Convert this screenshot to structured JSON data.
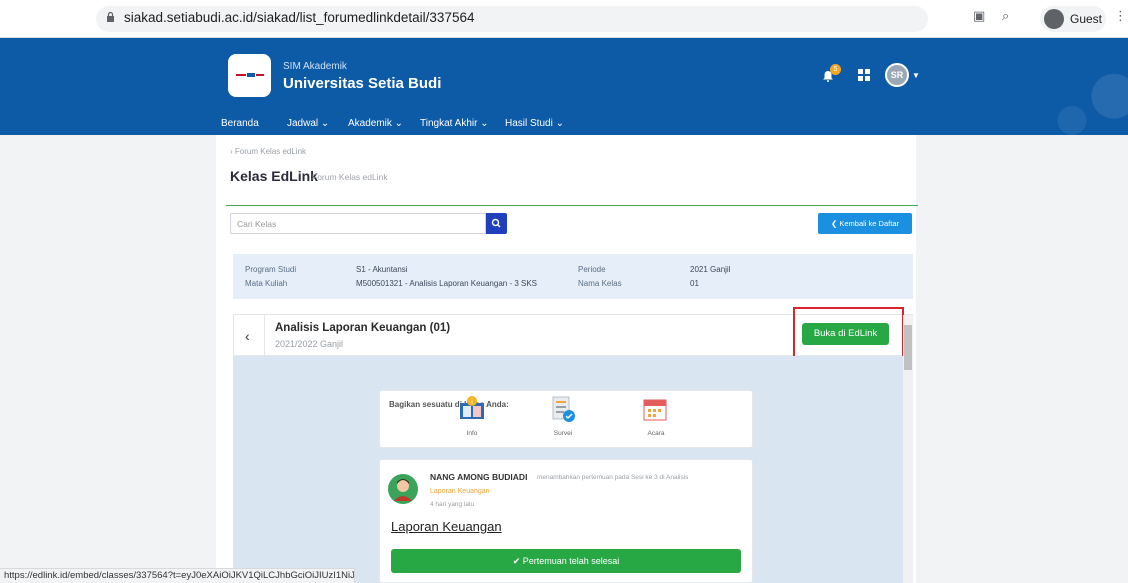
{
  "browser": {
    "url": "siakad.setiabudi.ac.id/siakad/list_forumedlinkdetail/337564",
    "profile_label": "Guest",
    "status_url": "https://edlink.id/embed/classes/337564?t=eyJ0eXAiOiJKV1QiLCJhbGciOiJIUzI1NiJ..."
  },
  "header": {
    "app_label": "SIM Akademik",
    "university": "Universitas Setia Budi",
    "notification_count": "5",
    "avatar_initials": "SR",
    "menu": [
      "Beranda",
      "Jadwal",
      "Akademik",
      "Tingkat Akhir",
      "Hasil Studi"
    ]
  },
  "page": {
    "breadcrumb": "Forum Kelas edLink",
    "title": "Kelas EdLink",
    "subtitle": "Forum Kelas edLink",
    "search_placeholder": "Cari Kelas",
    "back_button": "Kembali ke Daftar"
  },
  "info": {
    "program_label": "Program Studi",
    "program_value": "S1 - Akuntansi",
    "course_label": "Mata Kuliah",
    "course_value": "M500501321 - Analisis Laporan Keuangan - 3 SKS",
    "period_label": "Periode",
    "period_value": "2021 Ganjil",
    "class_label": "Nama Kelas",
    "class_value": "01"
  },
  "embed": {
    "class_title": "Analisis Laporan Keuangan (01)",
    "class_period": "2021/2022 Ganjil",
    "open_button": "Buka di EdLink",
    "share_title": "Bagikan sesuatu di kelas Anda:",
    "share_items": [
      "Info",
      "Survei",
      "Acara"
    ]
  },
  "post": {
    "author": "NANG AMONG BUDIADI",
    "action": "menambahkan pertemuan pada Sesi ke 3 di Analisis",
    "action_cont": "Laporan Keuangan",
    "time": "4 hari yang lalu",
    "heading": "Laporan Keuangan",
    "status": "Pertemuan telah selesai"
  },
  "colors": {
    "header_blue": "#0d5aa7",
    "accent_green": "#28a745",
    "highlight_red": "#d9232d"
  }
}
